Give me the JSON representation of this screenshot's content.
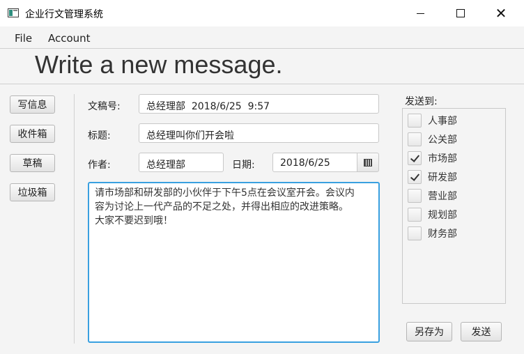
{
  "window": {
    "title": "企业行文管理系统",
    "controls": {
      "minimize": "minimize-icon",
      "maximize": "maximize-icon",
      "close": "close-icon",
      "close_glyph": "✕"
    }
  },
  "menu": {
    "file": "File",
    "account": "Account"
  },
  "heading": "Write a new message.",
  "sidebar": {
    "items": [
      {
        "label": "写信息"
      },
      {
        "label": "收件箱"
      },
      {
        "label": "草稿"
      },
      {
        "label": "垃圾箱"
      }
    ]
  },
  "form": {
    "doc_no_label": "文稿号:",
    "doc_no_value": "总经理部  2018/6/25  9:57",
    "title_label": "标题:",
    "title_value": "总经理叫你们开会啦",
    "author_label": "作者:",
    "author_value": "总经理部",
    "date_label": "日期:",
    "date_value": "2018/6/25",
    "body_lines": [
      "请市场部和研发部的小伙伴于下午5点在会议室开会。会议内",
      "容为讨论上一代产品的不足之处，并得出相应的改进策略。",
      "大家不要迟到哦！"
    ]
  },
  "send_to": {
    "label": "发送到:",
    "departments": [
      {
        "name": "人事部",
        "checked": false
      },
      {
        "name": "公关部",
        "checked": false
      },
      {
        "name": "市场部",
        "checked": true
      },
      {
        "name": "研发部",
        "checked": true
      },
      {
        "name": "营业部",
        "checked": false
      },
      {
        "name": "规划部",
        "checked": false
      },
      {
        "name": "财务部",
        "checked": false
      }
    ]
  },
  "actions": {
    "save_as": "另存为",
    "send": "发送"
  },
  "colors": {
    "focus_border": "#39a0e0",
    "window_bg": "#f4f4f4"
  }
}
